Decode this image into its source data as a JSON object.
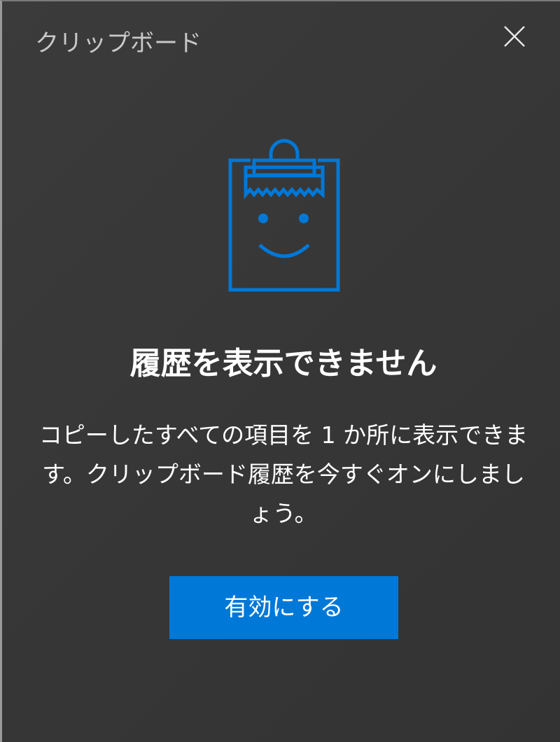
{
  "window": {
    "title": "クリップボード",
    "close_icon": "close-icon"
  },
  "illustration": {
    "icon": "clipboard-smile-icon",
    "color": "#0078d7"
  },
  "message": {
    "heading": "履歴を表示できません",
    "description": "コピーしたすべての項目を 1 か所に表示できます。クリップボード履歴を今すぐオンにしましょう。"
  },
  "actions": {
    "enable_label": "有効にする",
    "enable_color": "#0078d7"
  }
}
